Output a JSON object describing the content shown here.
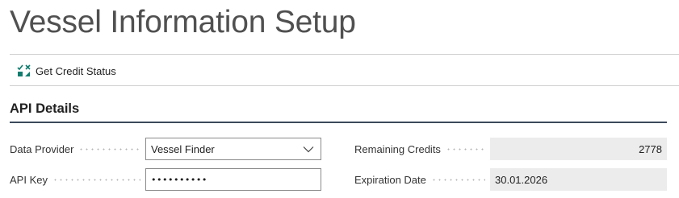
{
  "page": {
    "title": "Vessel Information Setup"
  },
  "actions": {
    "get_credit_status": {
      "label": "Get Credit Status",
      "icon": "credit-status-icon"
    }
  },
  "section": {
    "title": "API Details"
  },
  "fields": {
    "data_provider": {
      "label": "Data Provider",
      "value": "Vessel Finder"
    },
    "api_key": {
      "label": "API Key",
      "value": "••••••••••"
    },
    "remaining_credits": {
      "label": "Remaining Credits",
      "value": "2778"
    },
    "expiration_date": {
      "label": "Expiration Date",
      "value": "30.01.2026"
    }
  },
  "colors": {
    "icon_teal": "#107c6e",
    "section_rule": "#3c4a5a",
    "readonly_bg": "#ececec"
  }
}
